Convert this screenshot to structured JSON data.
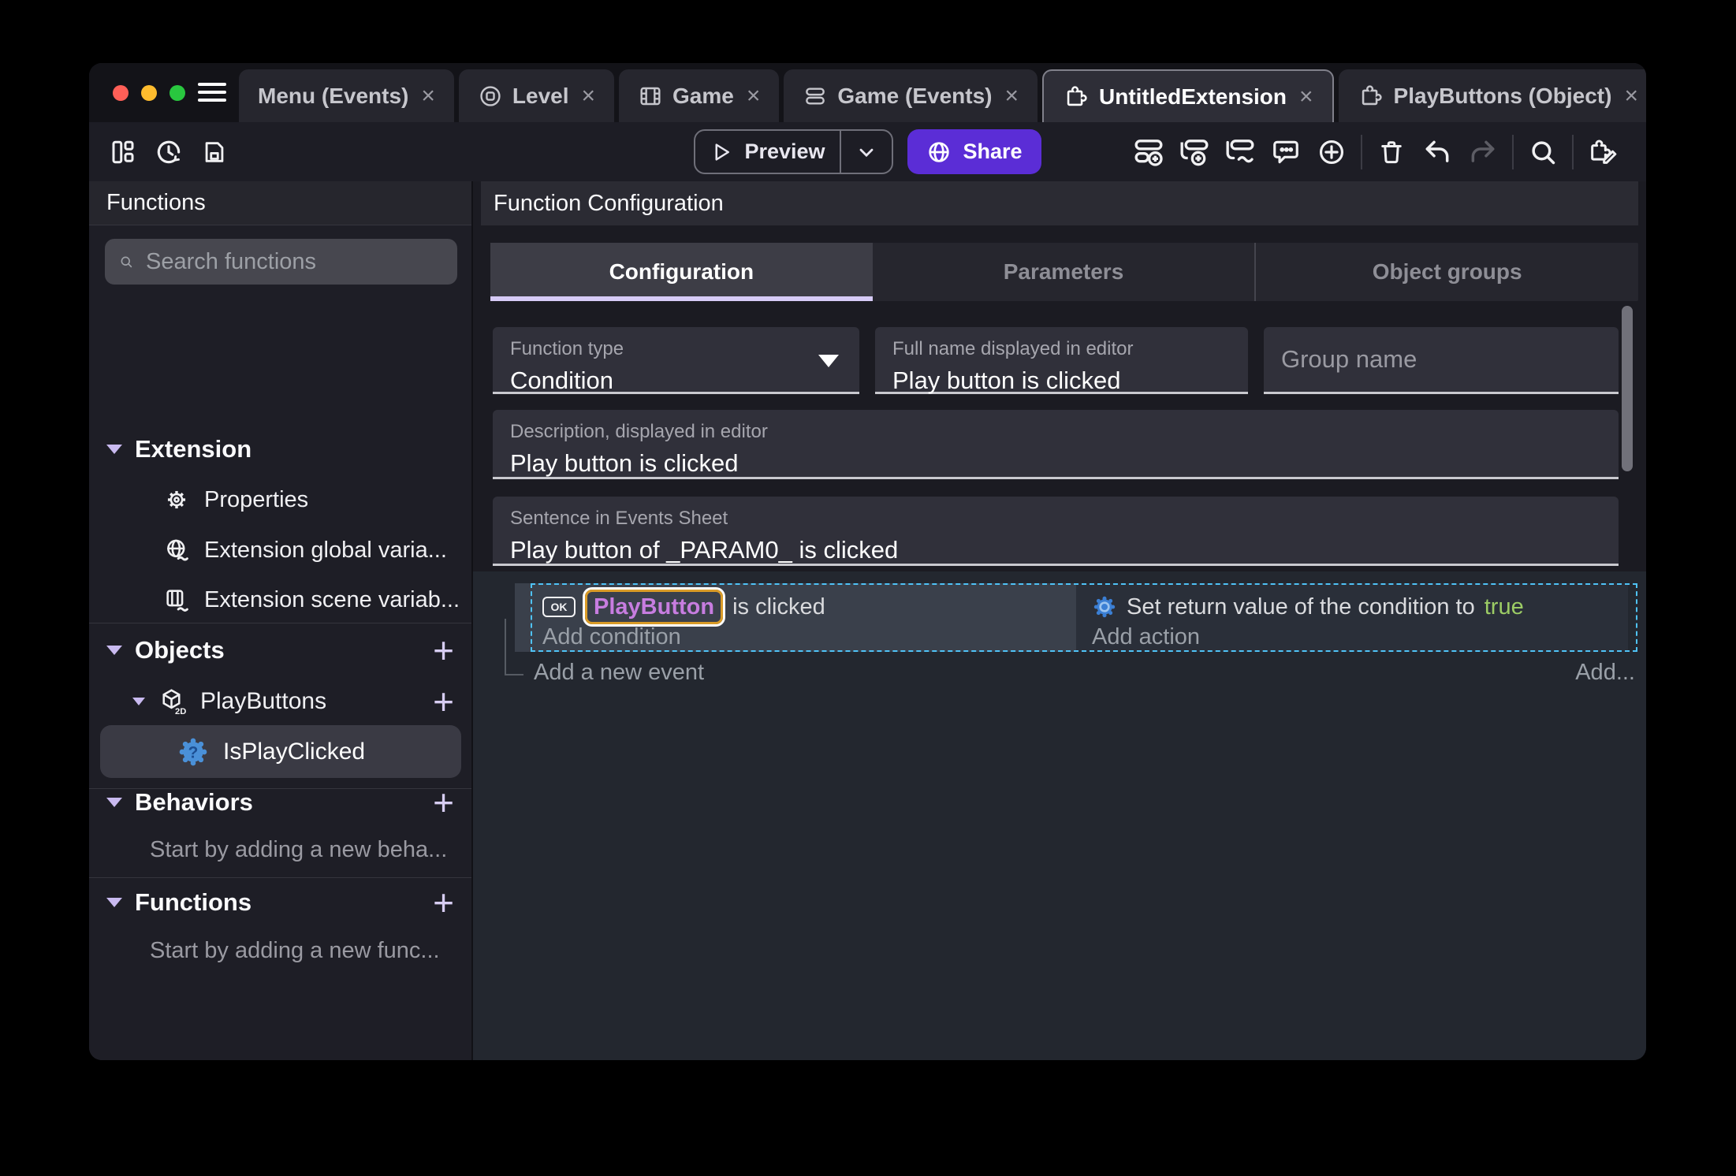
{
  "titlebar": {
    "close_glyph": "×",
    "tabs": [
      {
        "label": "Menu (Events)"
      },
      {
        "label": "Level"
      },
      {
        "label": "Game"
      },
      {
        "label": "Game (Events)"
      },
      {
        "label": "UntitledExtension"
      },
      {
        "label": "PlayButtons (Object)"
      }
    ]
  },
  "toolbar": {
    "preview": "Preview",
    "share": "Share"
  },
  "sidebar": {
    "title": "Functions",
    "search_placeholder": "Search functions",
    "plus_glyph": "+",
    "extension_section": "Extension",
    "properties": "Properties",
    "global_vars": "Extension global varia...",
    "scene_vars": "Extension scene variab...",
    "objects_section": "Objects",
    "playbuttons": "PlayButtons",
    "playbuttons_badge": "2D",
    "isplayclicked": "IsPlayClicked",
    "behaviors_section": "Behaviors",
    "behaviors_empty": "Start by adding a new beha...",
    "functions_section": "Functions",
    "functions_empty": "Start by adding a new func..."
  },
  "main": {
    "header": "Function Configuration",
    "tabs": [
      {
        "label": "Configuration"
      },
      {
        "label": "Parameters"
      },
      {
        "label": "Object groups"
      }
    ],
    "fields": {
      "function_type_label": "Function type",
      "function_type_value": "Condition",
      "full_name_label": "Full name displayed in editor",
      "full_name_value": "Play button is clicked",
      "group_name_placeholder": "Group name",
      "description_label": "Description, displayed in editor",
      "description_value": "Play button is clicked",
      "sentence_label": "Sentence in Events Sheet",
      "sentence_value": "Play button of _PARAM0_ is clicked"
    },
    "events": {
      "ok_badge": "OK",
      "condition_object": "PlayButton",
      "condition_suffix": "is clicked",
      "add_condition": "Add condition",
      "action_text": "Set return value of the condition to",
      "action_value": "true",
      "add_action": "Add action",
      "add_new_event": "Add a new event",
      "add_ellipsis": "Add..."
    }
  },
  "colors": {
    "accent_purple": "#5b2dd6",
    "tab_underline": "#d7cbf7",
    "object_text": "#c77de0",
    "object_highlight_border": "#d99b28",
    "highlight_ring": "#ffffff",
    "true_green": "#9ccc65",
    "selection_dash_blue": "#4fc3f7",
    "traffic_red": "#ff5f57",
    "traffic_yellow": "#febc2e",
    "traffic_green": "#29c73f",
    "gear_blue": "#4a90d8"
  }
}
